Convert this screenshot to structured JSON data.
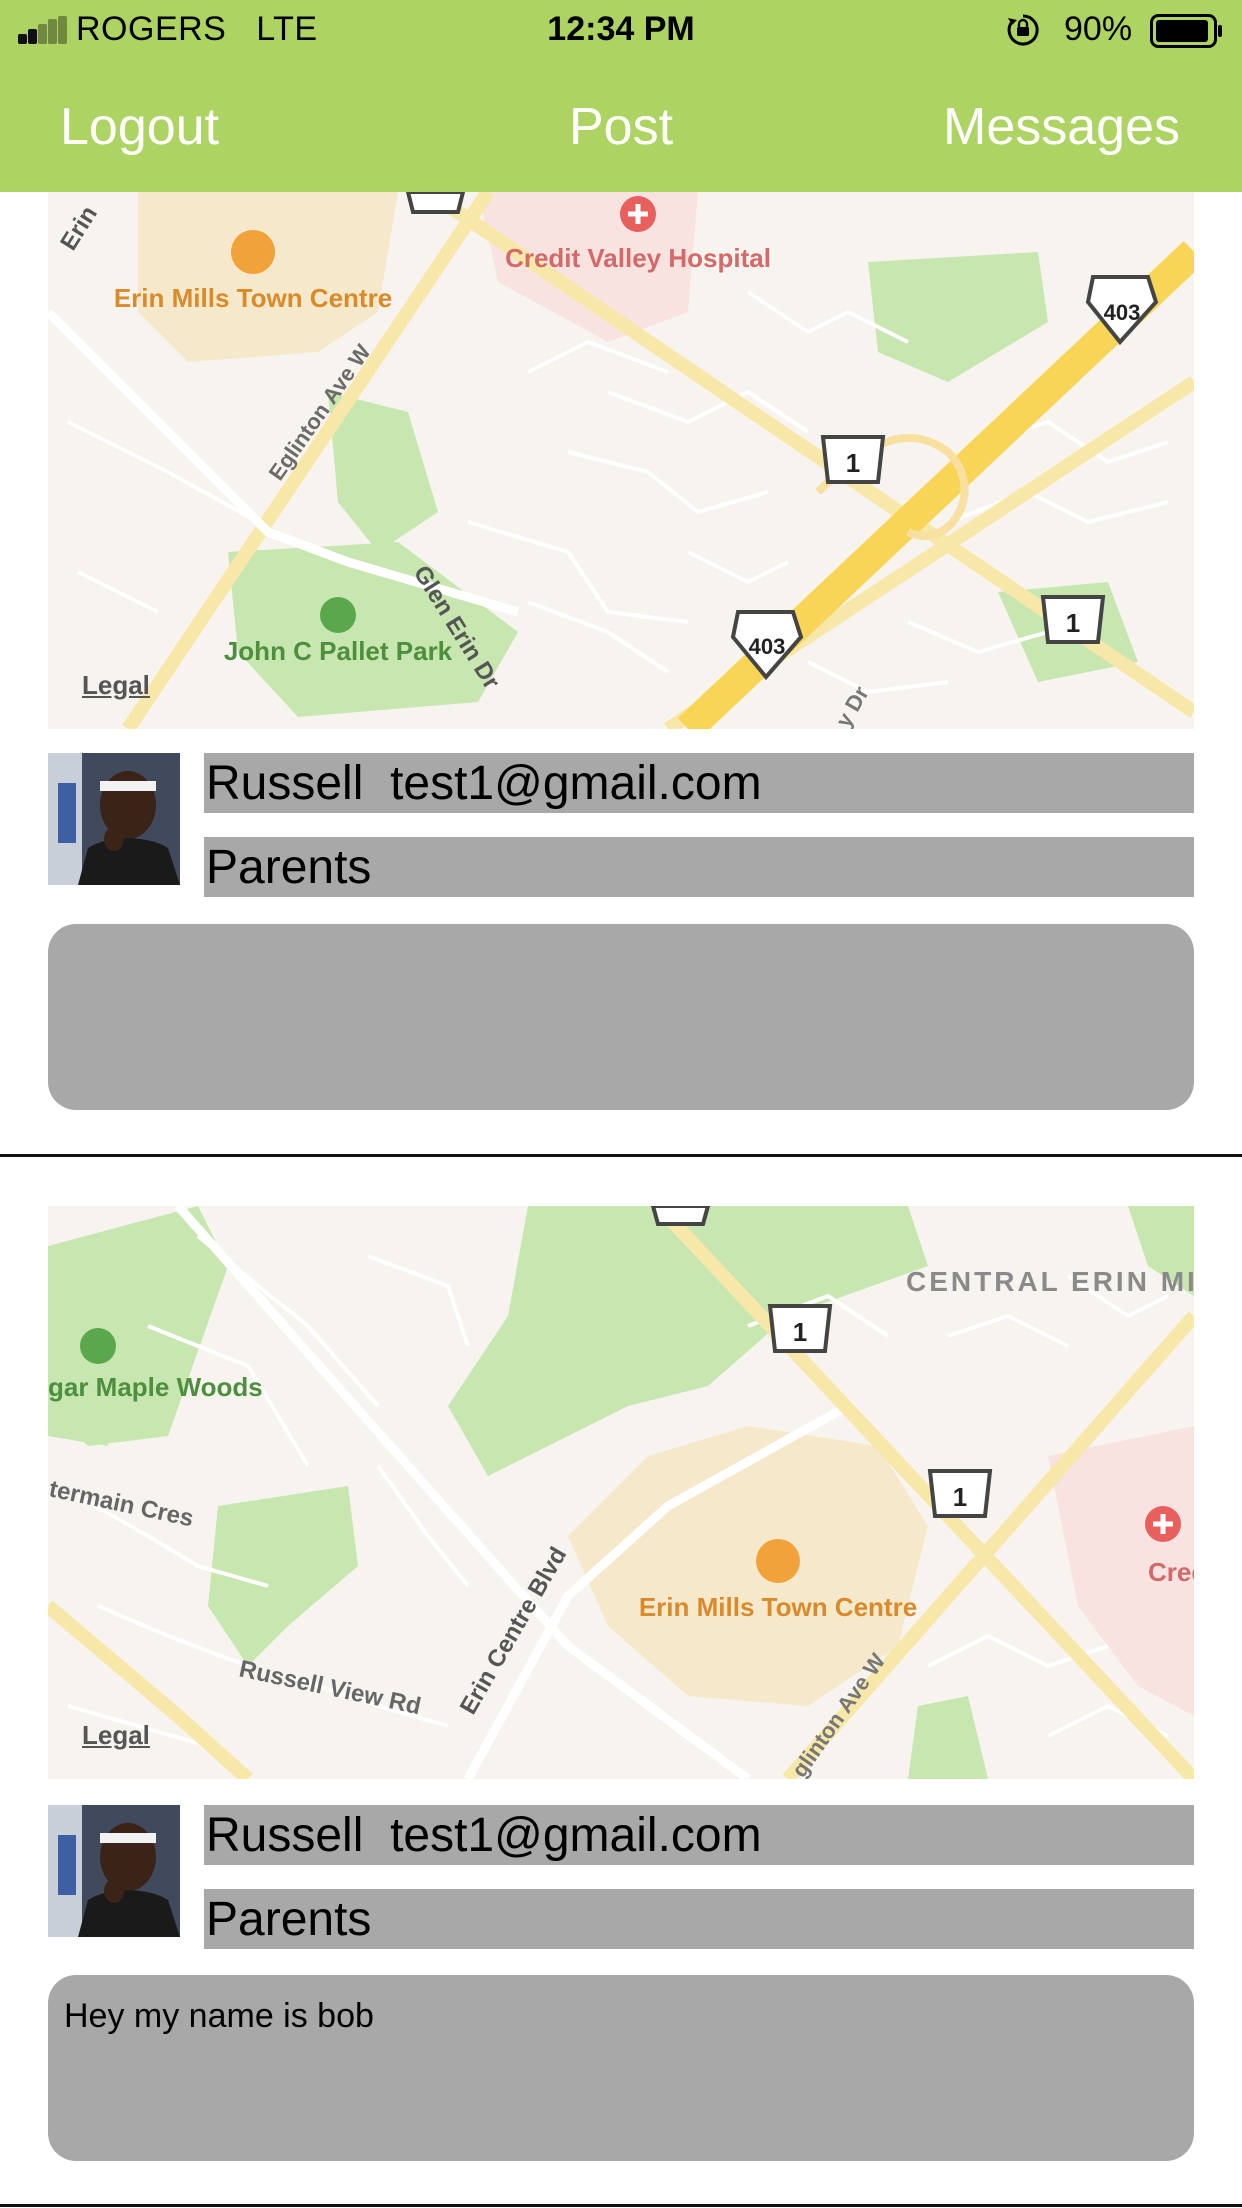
{
  "status_bar": {
    "carrier": "ROGERS",
    "network": "LTE",
    "time": "12:34 PM",
    "battery": "90%",
    "signal_bars": 5,
    "signal_bars_filled": 2,
    "battery_level": 0.9
  },
  "nav": {
    "left": "Logout",
    "center": "Post",
    "right": "Messages"
  },
  "colors": {
    "header_bg": "#add362",
    "field_bg": "#a8a8a8"
  },
  "posts": [
    {
      "map": {
        "legal": "Legal",
        "labels": {
          "mall": "Erin Mills Town Centre",
          "hospital": "Credit Valley Hospital",
          "park": "John C Pallet Park",
          "street_1": "Eglinton Ave W",
          "street_2": "Glen Erin Dr",
          "street_3": "Erin",
          "street_4": "y Dr",
          "shield_1": "1",
          "shield_2": "1",
          "shield_403a": "403",
          "shield_403b": "403"
        }
      },
      "name": "Russell",
      "email": "test1@gmail.com",
      "group": "Parents",
      "message": ""
    },
    {
      "map": {
        "legal": "Legal",
        "labels": {
          "district": "CENTRAL ERIN MILLS",
          "mall": "Erin Mills Town Centre",
          "hospital": "Credi Valley Hospit",
          "park": "gar Maple Woods",
          "street_1": "termain Cres",
          "street_2": "Erin Centre Blvd",
          "street_3": "Russell View Rd",
          "street_4": "glinton Ave W",
          "shield_1": "1",
          "shield_2": "1"
        }
      },
      "name": "Russell",
      "email": "test1@gmail.com",
      "group": "Parents",
      "message": "Hey my name is bob"
    }
  ]
}
